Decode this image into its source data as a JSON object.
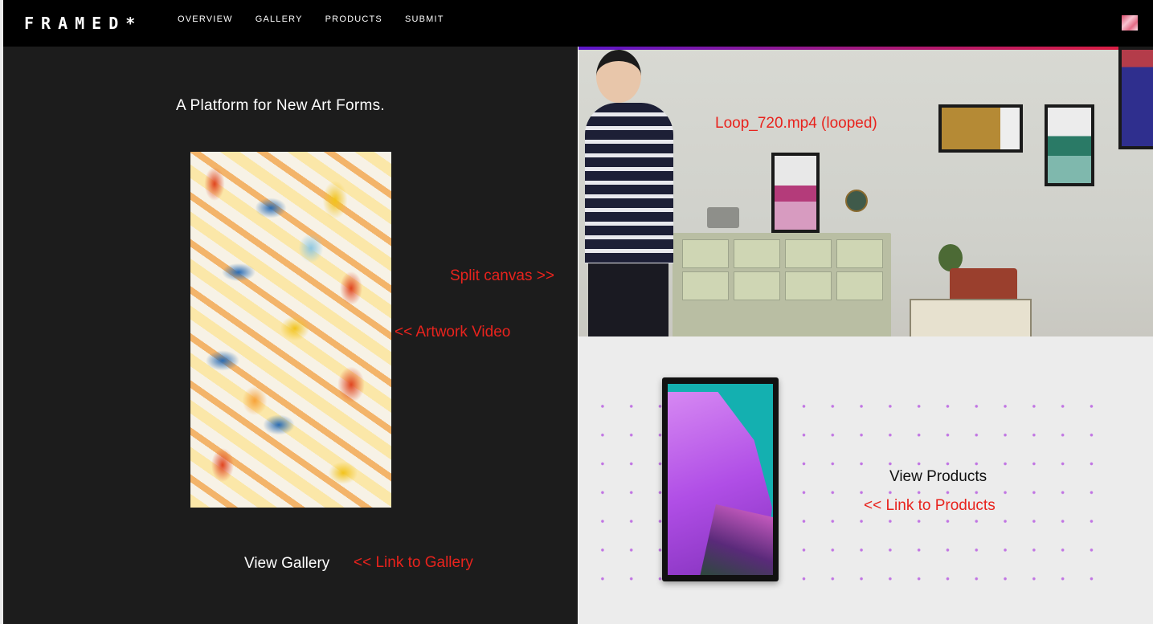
{
  "nav": {
    "logo": "FRAMED*",
    "links": [
      "OVERVIEW",
      "GALLERY",
      "PRODUCTS",
      "SUBMIT"
    ]
  },
  "left": {
    "tagline": "A Platform for New Art Forms.",
    "gallery_link": "View Gallery"
  },
  "products": {
    "link": "View Products"
  },
  "annotations": {
    "split_canvas": "Split canvas >>",
    "artwork_video": "<< Artwork Video",
    "link_to_gallery": "<< Link to Gallery",
    "video_file": "Loop_720.mp4 (looped)",
    "link_to_products": "<< Link to Products"
  },
  "colors": {
    "nav_bg": "#000000",
    "left_bg": "#1c1c1c",
    "annotation": "#e8231d",
    "products_bg": "#ececec"
  }
}
